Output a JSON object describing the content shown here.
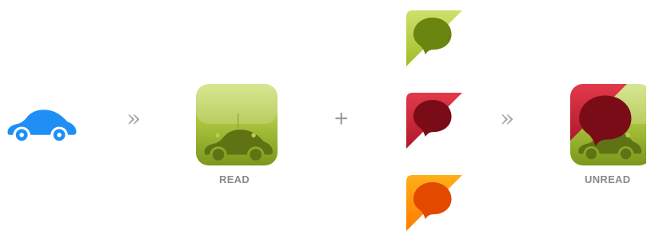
{
  "read_icon": {
    "caption": "READ"
  },
  "unread_icon": {
    "caption": "UNREAD"
  },
  "operators": {
    "arrow_1": "»",
    "plus": "+",
    "arrow_2": "»"
  },
  "colors": {
    "car_blue": "#1f8ff5",
    "tile_green_light": "#c8dd6e",
    "tile_green_dark": "#7f9b1c",
    "car_olive": "#5f7314",
    "corner_green": "#b3cc3a",
    "corner_red": "#c21c34",
    "corner_orange": "#ff8a00",
    "label_gray": "#8a8a8a"
  },
  "icons": {
    "source_car": "car-icon",
    "read_tile": "read-car-tile-icon",
    "unread_tile": "unread-car-tile-icon",
    "corner_variants": [
      "green-speech-corner-icon",
      "red-speech-corner-icon",
      "orange-speech-corner-icon"
    ]
  }
}
